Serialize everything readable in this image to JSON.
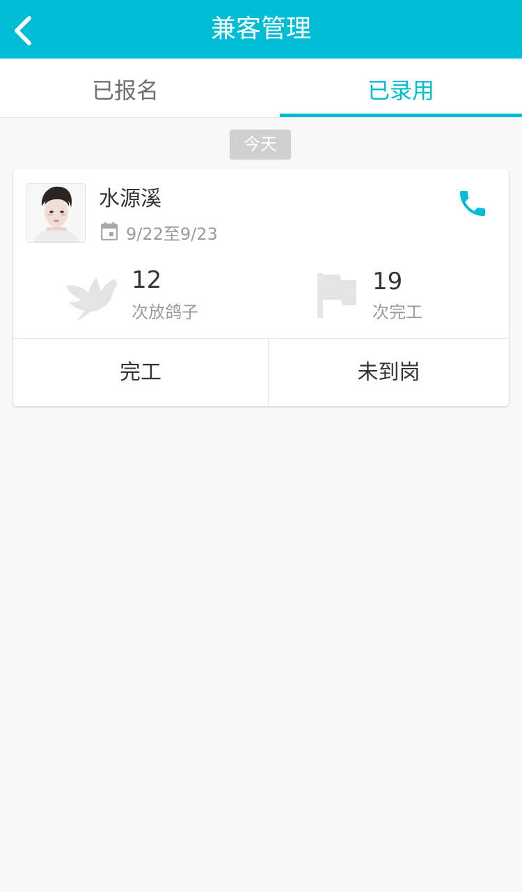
{
  "header": {
    "title": "兼客管理",
    "back_icon": "chevron-left-icon",
    "bg_color": "#00bcd4"
  },
  "tabs": [
    {
      "label": "已报名",
      "active": false
    },
    {
      "label": "已录用",
      "active": true
    }
  ],
  "accent_color": "#00bcd4",
  "section": {
    "date_label": "今天"
  },
  "worker": {
    "name": "水源溪",
    "date_range": "9/22至9/23",
    "stats": [
      {
        "icon": "dove-icon",
        "value": "12",
        "label": "次放鸽子"
      },
      {
        "icon": "flag-icon",
        "value": "19",
        "label": "次完工"
      }
    ],
    "actions": {
      "complete": "完工",
      "absent": "未到岗"
    }
  }
}
